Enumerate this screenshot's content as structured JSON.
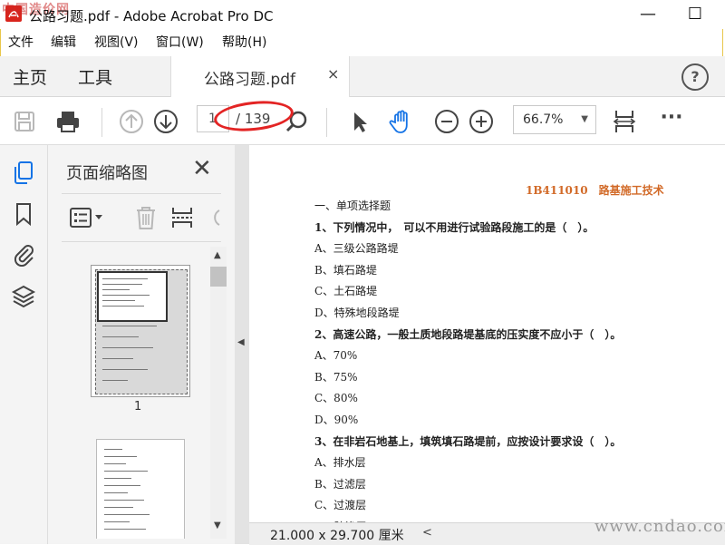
{
  "window": {
    "title": "公路习题.pdf - Adobe Acrobat Pro DC",
    "minimize": "—",
    "maximize": "☐"
  },
  "menu": {
    "items": [
      "文件",
      "编辑",
      "视图(V)",
      "窗口(W)",
      "帮助(H)"
    ]
  },
  "nav": {
    "home": "主页",
    "tools": "工具",
    "tab_label": "公路习题.pdf",
    "tab_close": "×",
    "help": "?"
  },
  "toolbar": {
    "current_page": "1",
    "total_pages": "/ 139",
    "zoom": "66.7%",
    "more": "···"
  },
  "sidebar": {
    "panel_title": "页面缩略图",
    "close": "✕",
    "thumb_page_label": "1"
  },
  "document": {
    "header": "1B411010　路基施工技术",
    "lines": [
      {
        "text": "一、单项选择题",
        "bold": false
      },
      {
        "text": "1、下列情况中，　可以不用进行试验路段施工的是（　）。",
        "bold": true
      },
      {
        "text": "A、三级公路路堤",
        "bold": false
      },
      {
        "text": "B、填石路堤",
        "bold": false
      },
      {
        "text": "C、土石路堤",
        "bold": false
      },
      {
        "text": "D、特殊地段路堤",
        "bold": false
      },
      {
        "text": "2、高速公路，一般土质地段路堤基底的压实度不应小于（　）。",
        "bold": true
      },
      {
        "text": "A、70%",
        "bold": false
      },
      {
        "text": "B、75%",
        "bold": false
      },
      {
        "text": "C、80%",
        "bold": false
      },
      {
        "text": "D、90%",
        "bold": false
      },
      {
        "text": "3、在非岩石地基上，填筑填石路堤前，应按设计要求设（　）。",
        "bold": true
      },
      {
        "text": "A、排水层",
        "bold": false
      },
      {
        "text": "B、过滤层",
        "bold": false
      },
      {
        "text": "C、过渡层",
        "bold": false
      },
      {
        "text": "D、防渗层",
        "bold": false
      }
    ]
  },
  "status": {
    "page_size": "21.000 x 29.700 厘米"
  },
  "watermarks": {
    "top_left": "中国造价网",
    "bottom_right": "www.cndao.com"
  },
  "colors": {
    "accent_blue": "#1473e6",
    "header_orange": "#d26a28",
    "annotation_red": "#e32424"
  },
  "icons": {
    "left_rail": [
      "page-thumbnails-icon",
      "bookmark-icon",
      "attachment-icon",
      "layers-icon"
    ]
  }
}
